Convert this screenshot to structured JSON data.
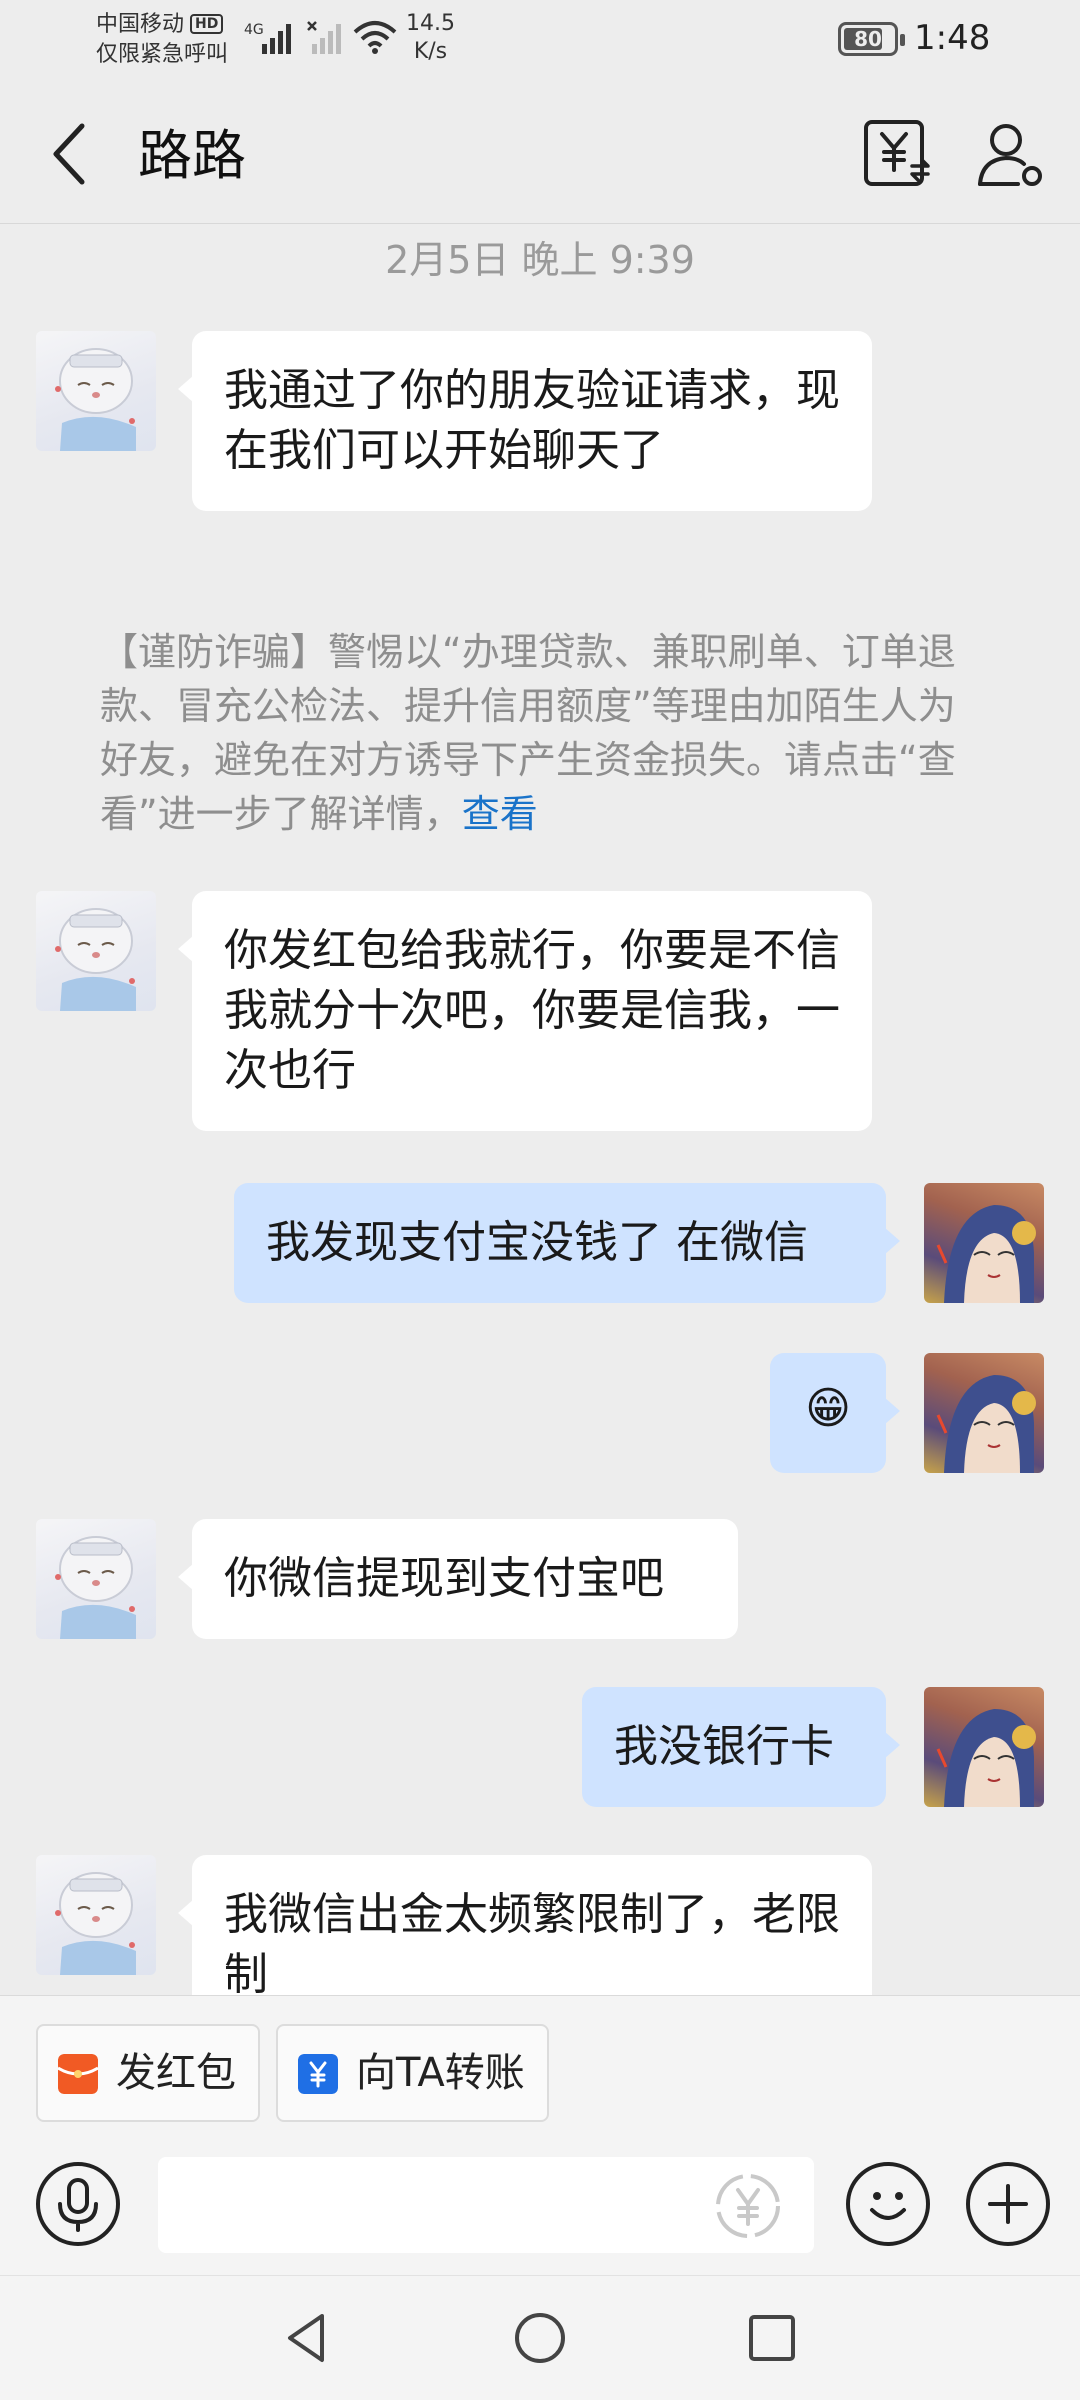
{
  "status_bar": {
    "carrier": "中国移动",
    "hd_badge": "HD",
    "emergency": "仅限紧急呼叫",
    "network": "4G",
    "net_speed_value": "14.5",
    "net_speed_unit": "K/s",
    "battery": "80",
    "battery_level": 0.8,
    "time": "1:48"
  },
  "header": {
    "contact_name": "路路",
    "icons": [
      "back-arrow-icon",
      "money-transfer-icon",
      "contact-profile-icon"
    ]
  },
  "chat": {
    "timestamp": "2月5日 晚上 9:39",
    "messages": [
      {
        "from": "contact",
        "text": "我通过了你的朋友验证请求，现在我们可以开始聊天了"
      },
      {
        "from": "contact",
        "text": "你发红包给我就行，你要是不信我就分十次吧，你要是信我，一次也行"
      },
      {
        "from": "me",
        "text": "我发现支付宝没钱了 在微信"
      },
      {
        "from": "me",
        "text": "😁"
      },
      {
        "from": "contact",
        "text": "你微信提现到支付宝吧"
      },
      {
        "from": "me",
        "text": "我没银行卡"
      },
      {
        "from": "contact",
        "text": "我微信出金太频繁限制了，老限制"
      }
    ],
    "warning": {
      "text": "【谨防诈骗】警惕以“办理贷款、兼职刷单、订单退款、冒充公检法、提升信用额度”等理由加陌生人为好友，避免在对方诱导下产生资金损失。请点击“查看”进一步了解详情，",
      "link": "查看"
    }
  },
  "quick_actions": [
    {
      "label": "发红包",
      "icon": "red-packet-icon",
      "color": "#f15a24"
    },
    {
      "label": "向TA转账",
      "icon": "transfer-icon",
      "color": "#1f6fe5"
    }
  ],
  "input_bar": {
    "placeholder": "",
    "icons": [
      "voice-icon",
      "money-icon",
      "emoji-icon",
      "plus-icon"
    ]
  },
  "nav_bar": {
    "icons": [
      "nav-back-icon",
      "nav-home-icon",
      "nav-recents-icon"
    ]
  },
  "colors": {
    "background": "#ededed",
    "bubble_in": "#ffffff",
    "bubble_out": "#cfe3ff",
    "link": "#1a73c9"
  }
}
